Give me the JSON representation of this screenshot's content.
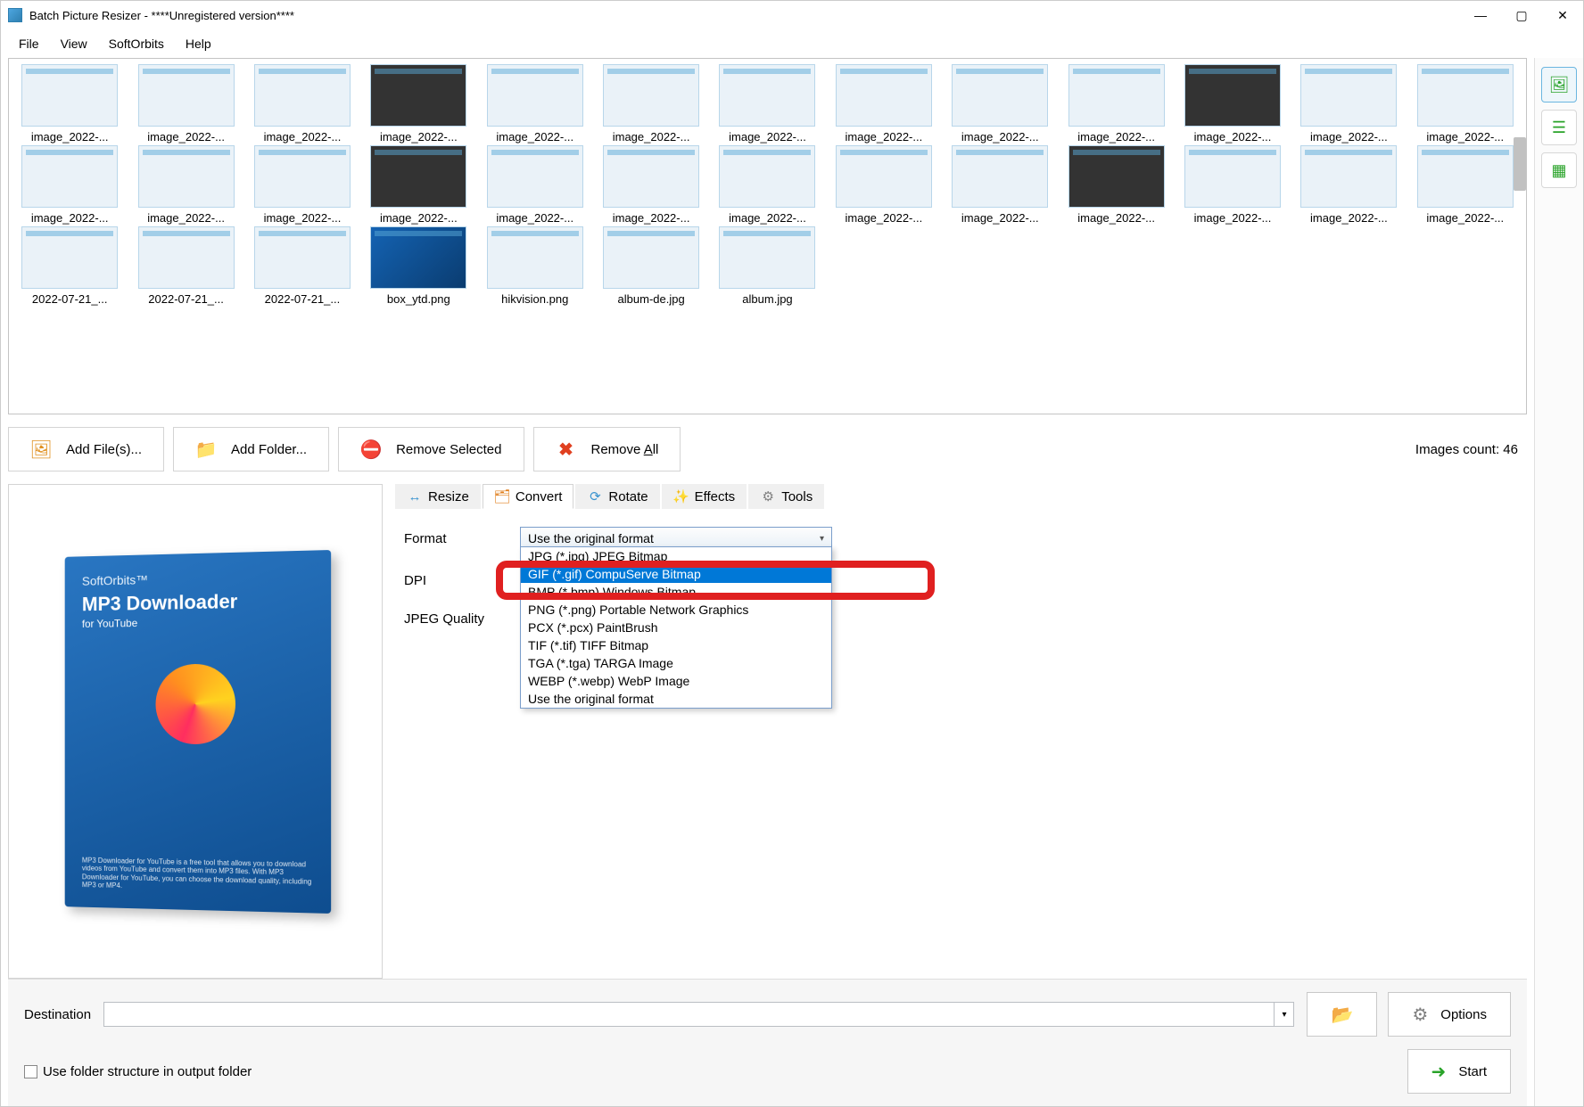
{
  "title": "Batch Picture Resizer - ****Unregistered version****",
  "menu": {
    "file": "File",
    "view": "View",
    "softorbits": "SoftOrbits",
    "help": "Help"
  },
  "thumbs": [
    {
      "label": "image_2022-...",
      "kind": "app"
    },
    {
      "label": "image_2022-...",
      "kind": "app"
    },
    {
      "label": "image_2022-...",
      "kind": "app"
    },
    {
      "label": "image_2022-...",
      "kind": "dark"
    },
    {
      "label": "image_2022-...",
      "kind": "app"
    },
    {
      "label": "image_2022-...",
      "kind": "app"
    },
    {
      "label": "image_2022-...",
      "kind": "app"
    },
    {
      "label": "image_2022-...",
      "kind": "app"
    },
    {
      "label": "image_2022-...",
      "kind": "app"
    },
    {
      "label": "image_2022-...",
      "kind": "app"
    },
    {
      "label": "image_2022-...",
      "kind": "dark"
    },
    {
      "label": "image_2022-...",
      "kind": "app"
    },
    {
      "label": "image_2022-...",
      "kind": "app"
    },
    {
      "label": "image_2022-...",
      "kind": "app"
    },
    {
      "label": "image_2022-...",
      "kind": "app"
    },
    {
      "label": "image_2022-...",
      "kind": "app"
    },
    {
      "label": "image_2022-...",
      "kind": "dark"
    },
    {
      "label": "image_2022-...",
      "kind": "app"
    },
    {
      "label": "image_2022-...",
      "kind": "app"
    },
    {
      "label": "image_2022-...",
      "kind": "app"
    },
    {
      "label": "image_2022-...",
      "kind": "app"
    },
    {
      "label": "image_2022-...",
      "kind": "app"
    },
    {
      "label": "image_2022-...",
      "kind": "dark"
    },
    {
      "label": "image_2022-...",
      "kind": "app"
    },
    {
      "label": "image_2022-...",
      "kind": "app"
    },
    {
      "label": "image_2022-...",
      "kind": "app"
    },
    {
      "label": "2022-07-21_...",
      "kind": "app"
    },
    {
      "label": "2022-07-21_...",
      "kind": "app"
    },
    {
      "label": "2022-07-21_...",
      "kind": "app"
    },
    {
      "label": "box_ytd.png",
      "kind": "box"
    },
    {
      "label": "hikvision.png",
      "kind": "app"
    },
    {
      "label": "album-de.jpg",
      "kind": "app"
    },
    {
      "label": "album.jpg",
      "kind": "app"
    }
  ],
  "actions": {
    "addFiles": "Add File(s)...",
    "addFolder": "Add Folder...",
    "removeSelected": "Remove Selected",
    "removeAll": "Remove All",
    "countLabel": "Images count: 46"
  },
  "product": {
    "brand": "SoftOrbits™",
    "name": "MP3 Downloader",
    "sub": "for YouTube",
    "desc": "MP3 Downloader for YouTube is a free tool that allows you to download videos from YouTube and convert them into MP3 files. With MP3 Downloader for YouTube, you can choose the download quality, including MP3 or MP4."
  },
  "tabs": {
    "resize": "Resize",
    "convert": "Convert",
    "rotate": "Rotate",
    "effects": "Effects",
    "tools": "Tools"
  },
  "form": {
    "format": "Format",
    "dpi": "DPI",
    "jpegQuality": "JPEG Quality",
    "selectedFormat": "Use the original format",
    "options": [
      "JPG (*.jpg) JPEG Bitmap",
      "GIF (*.gif) CompuServe Bitmap",
      "BMP (*.bmp) Windows Bitmap",
      "PNG (*.png) Portable Network Graphics",
      "PCX (*.pcx) PaintBrush",
      "TIF (*.tif) TIFF Bitmap",
      "TGA (*.tga) TARGA Image",
      "WEBP (*.webp) WebP Image",
      "Use the original format"
    ],
    "highlightedIndex": 1
  },
  "bottom": {
    "destination": "Destination",
    "useFolderStructure": "Use folder structure in output folder",
    "options": "Options",
    "start": "Start"
  }
}
